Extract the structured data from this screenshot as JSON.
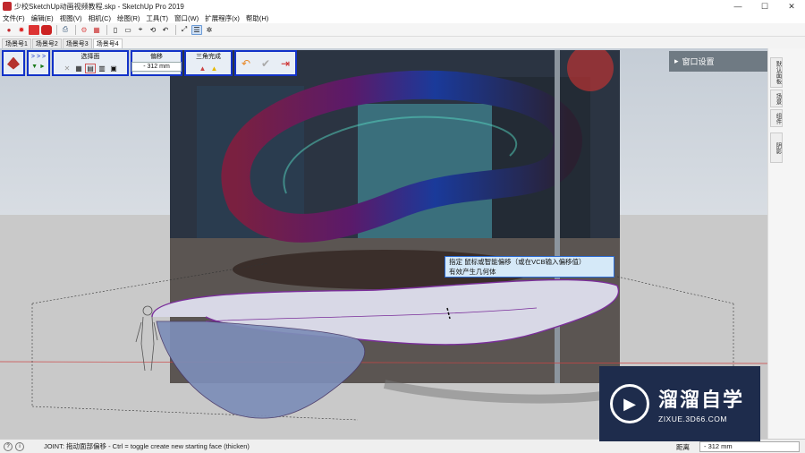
{
  "window": {
    "title": "少校SketchUp动画视频教程.skp - SketchUp Pro 2019",
    "minimize": "—",
    "maximize": "☐",
    "close": "✕"
  },
  "menu": [
    "文件(F)",
    "编辑(E)",
    "视图(V)",
    "相机(C)",
    "绘图(R)",
    "工具(T)",
    "窗口(W)",
    "扩展程序(x)",
    "帮助(H)"
  ],
  "scenes": [
    "场景号1",
    "场景号2",
    "场景号3",
    "场景号4"
  ],
  "active_scene_index": 3,
  "ext_toolbar": {
    "arrows_top": "> > >",
    "arrows_bottom": "▼ ►",
    "select_face_label": "选择面",
    "offset_label": "偏移",
    "offset_value": "- 312 mm",
    "triangulate_label": "三角完成"
  },
  "tooltip": {
    "line1": "指定 鼠标或智能偏移（或在VCB输入偏移值）",
    "line2": "有效产生几何体"
  },
  "panel": {
    "title": "窗口设置",
    "close": "✕"
  },
  "tray_tabs": [
    "默认面板",
    "场景",
    "组件",
    "阴影"
  ],
  "status": {
    "message": "JOINT: 拖动面部偏移 - Ctrl = toggle create new starting face (thicken)",
    "measure_label": "距离",
    "measure_value": "- 312 mm"
  },
  "watermark": {
    "name": "溜溜自学",
    "url": "ZIXUE.3D66.COM"
  },
  "colors": {
    "accent_border": "#1232c8",
    "tooltip_bg": "#d5e9f8",
    "panel_bg": "#6f7a83",
    "logo_bg": "#1e2c4c"
  }
}
